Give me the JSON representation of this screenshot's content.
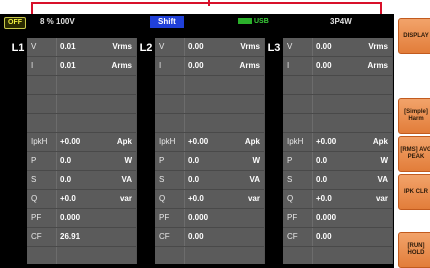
{
  "status": {
    "output": "OFF",
    "range": "8 % 100V",
    "shift": "Shift",
    "usb": "USB",
    "wiring": "3P4W"
  },
  "phases": [
    {
      "label": "L1",
      "rows": [
        {
          "param": "V",
          "value": "0.01",
          "unit": "Vrms"
        },
        {
          "param": "I",
          "value": "0.01",
          "unit": "Arms"
        },
        {
          "param": "",
          "value": "",
          "unit": ""
        },
        {
          "param": "",
          "value": "",
          "unit": ""
        },
        {
          "param": "",
          "value": "",
          "unit": ""
        },
        {
          "param": "IpkH",
          "value": "+0.00",
          "unit": "Apk"
        },
        {
          "param": "P",
          "value": "0.0",
          "unit": "W"
        },
        {
          "param": "S",
          "value": "0.0",
          "unit": "VA"
        },
        {
          "param": "Q",
          "value": "+0.0",
          "unit": "var"
        },
        {
          "param": "PF",
          "value": "0.000",
          "unit": ""
        },
        {
          "param": "CF",
          "value": "26.91",
          "unit": ""
        }
      ]
    },
    {
      "label": "L2",
      "rows": [
        {
          "param": "V",
          "value": "0.00",
          "unit": "Vrms"
        },
        {
          "param": "I",
          "value": "0.00",
          "unit": "Arms"
        },
        {
          "param": "",
          "value": "",
          "unit": ""
        },
        {
          "param": "",
          "value": "",
          "unit": ""
        },
        {
          "param": "",
          "value": "",
          "unit": ""
        },
        {
          "param": "IpkH",
          "value": "+0.00",
          "unit": "Apk"
        },
        {
          "param": "P",
          "value": "0.0",
          "unit": "W"
        },
        {
          "param": "S",
          "value": "0.0",
          "unit": "VA"
        },
        {
          "param": "Q",
          "value": "+0.0",
          "unit": "var"
        },
        {
          "param": "PF",
          "value": "0.000",
          "unit": ""
        },
        {
          "param": "CF",
          "value": "0.00",
          "unit": ""
        }
      ]
    },
    {
      "label": "L3",
      "rows": [
        {
          "param": "V",
          "value": "0.00",
          "unit": "Vrms"
        },
        {
          "param": "I",
          "value": "0.00",
          "unit": "Arms"
        },
        {
          "param": "",
          "value": "",
          "unit": ""
        },
        {
          "param": "",
          "value": "",
          "unit": ""
        },
        {
          "param": "",
          "value": "",
          "unit": ""
        },
        {
          "param": "IpkH",
          "value": "+0.00",
          "unit": "Apk"
        },
        {
          "param": "P",
          "value": "0.0",
          "unit": "W"
        },
        {
          "param": "S",
          "value": "0.0",
          "unit": "VA"
        },
        {
          "param": "Q",
          "value": "+0.0",
          "unit": "var"
        },
        {
          "param": "PF",
          "value": "0.000",
          "unit": ""
        },
        {
          "param": "CF",
          "value": "0.00",
          "unit": ""
        }
      ]
    }
  ],
  "softkeys": [
    {
      "label": "DISPLAY"
    },
    {
      "label": "[Simple] Harm"
    },
    {
      "label": "[RMS] AVG PEAK"
    },
    {
      "label": "IPK CLR"
    },
    {
      "label": "[RUN] HOLD"
    }
  ]
}
